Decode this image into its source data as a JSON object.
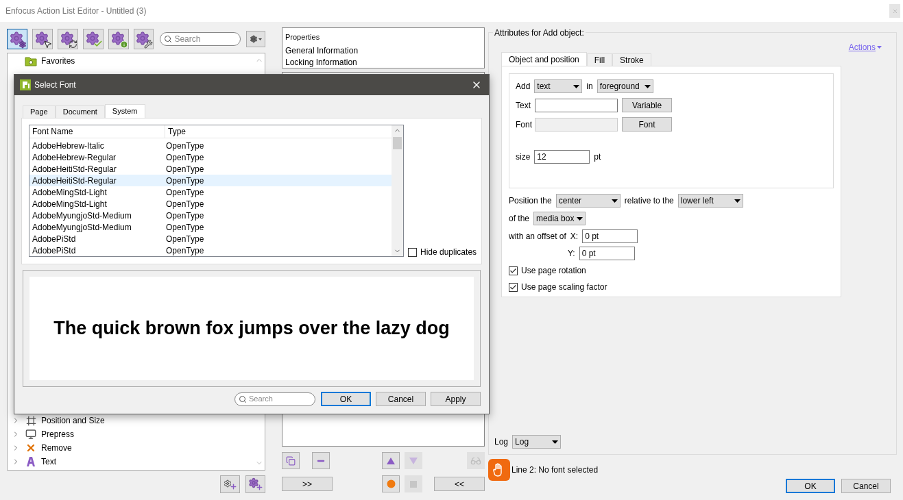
{
  "window": {
    "title": "Enfocus Action List Editor - Untitled (3)"
  },
  "left_panel": {
    "toolbar": [
      {
        "kind": "gears",
        "selected": true
      },
      {
        "kind": "cursor",
        "selected": false
      },
      {
        "kind": "cycle",
        "selected": false
      },
      {
        "kind": "check",
        "selected": false
      },
      {
        "kind": "info",
        "selected": false
      },
      {
        "kind": "wrench",
        "selected": false
      }
    ],
    "search": {
      "placeholder": "Search"
    },
    "tree": {
      "top": [
        {
          "label": "Favorites",
          "kind": "folder",
          "expandable": false
        }
      ],
      "bottom": [
        {
          "label": "Position and Size",
          "kind": "frame",
          "expandable": true
        },
        {
          "label": "Prepress",
          "kind": "monitor",
          "expandable": true
        },
        {
          "label": "Remove",
          "kind": "cross",
          "expandable": true
        },
        {
          "label": "Text",
          "kind": "letter",
          "expandable": true
        }
      ]
    }
  },
  "middle_panel": {
    "properties_list": [
      "Properties",
      "General Information",
      "Locking Information"
    ],
    "tool_buttons": [
      {
        "kind": "duplicate",
        "disabled": false
      },
      {
        "kind": "minus",
        "disabled": false
      },
      {
        "kind": "up",
        "disabled": false
      },
      {
        "kind": "down",
        "disabled": true
      },
      {
        "kind": "glasses",
        "disabled": true
      }
    ],
    "add_button": ">>",
    "record_buttons": [
      {
        "kind": "record",
        "disabled": false
      },
      {
        "kind": "stop",
        "disabled": true
      }
    ],
    "remove_button": "<<"
  },
  "attributes": {
    "title": "Attributes for Add object:",
    "actions_link": "Actions",
    "tabs": [
      {
        "label": "Object and position",
        "selected": true
      },
      {
        "label": "Fill",
        "selected": false
      },
      {
        "label": "Stroke",
        "selected": false
      }
    ],
    "add_label": "Add",
    "add_value": "text",
    "in_label": "in",
    "in_value": "foreground",
    "text_label": "Text",
    "variable_button": "Variable",
    "font_label": "Font",
    "font_button": "Font",
    "size_label": "size",
    "size_value": "12",
    "size_unit": "pt",
    "position_label": "Position the",
    "position_value": "center",
    "relative_label": "relative to the",
    "relative_value": "lower left",
    "of_label": "of the",
    "of_value": "media box",
    "offset_label": "with an offset of",
    "x_label": "X:",
    "x_value": "0 pt",
    "y_label": "Y:",
    "y_value": "0 pt",
    "checkboxes": [
      {
        "label": "Use page rotation",
        "checked": true
      },
      {
        "label": "Use page scaling factor",
        "checked": true
      }
    ],
    "log_label": "Log",
    "log_value": "Log"
  },
  "status": {
    "message": "Line 2: No font selected"
  },
  "buttons": [
    {
      "label": "OK",
      "default": true
    },
    {
      "label": "Cancel",
      "default": false
    }
  ],
  "dialog": {
    "title": "Select Font",
    "tabs": [
      {
        "label": "Page",
        "selected": false
      },
      {
        "label": "Document",
        "selected": false
      },
      {
        "label": "System",
        "selected": true
      }
    ],
    "columns": [
      "Font Name",
      "Type"
    ],
    "rows": [
      {
        "name": "AdobeHebrew-Italic",
        "type": "OpenType",
        "selected": false
      },
      {
        "name": "AdobeHebrew-Regular",
        "type": "OpenType",
        "selected": false
      },
      {
        "name": "AdobeHeitiStd-Regular",
        "type": "OpenType",
        "selected": false
      },
      {
        "name": "AdobeHeitiStd-Regular",
        "type": "OpenType",
        "selected": true
      },
      {
        "name": "AdobeMingStd-Light",
        "type": "OpenType",
        "selected": false
      },
      {
        "name": "AdobeMingStd-Light",
        "type": "OpenType",
        "selected": false
      },
      {
        "name": "AdobeMyungjoStd-Medium",
        "type": "OpenType",
        "selected": false
      },
      {
        "name": "AdobeMyungjoStd-Medium",
        "type": "OpenType",
        "selected": false
      },
      {
        "name": "AdobePiStd",
        "type": "OpenType",
        "selected": false
      },
      {
        "name": "AdobePiStd",
        "type": "OpenType",
        "selected": false
      }
    ],
    "hide_duplicates": {
      "label": "Hide duplicates",
      "checked": false
    },
    "preview": "The quick brown fox jumps over the lazy dog",
    "search": {
      "placeholder": "Search"
    },
    "buttons": [
      {
        "label": "OK",
        "default": true
      },
      {
        "label": "Cancel",
        "default": false
      },
      {
        "label": "Apply",
        "default": false
      }
    ]
  }
}
